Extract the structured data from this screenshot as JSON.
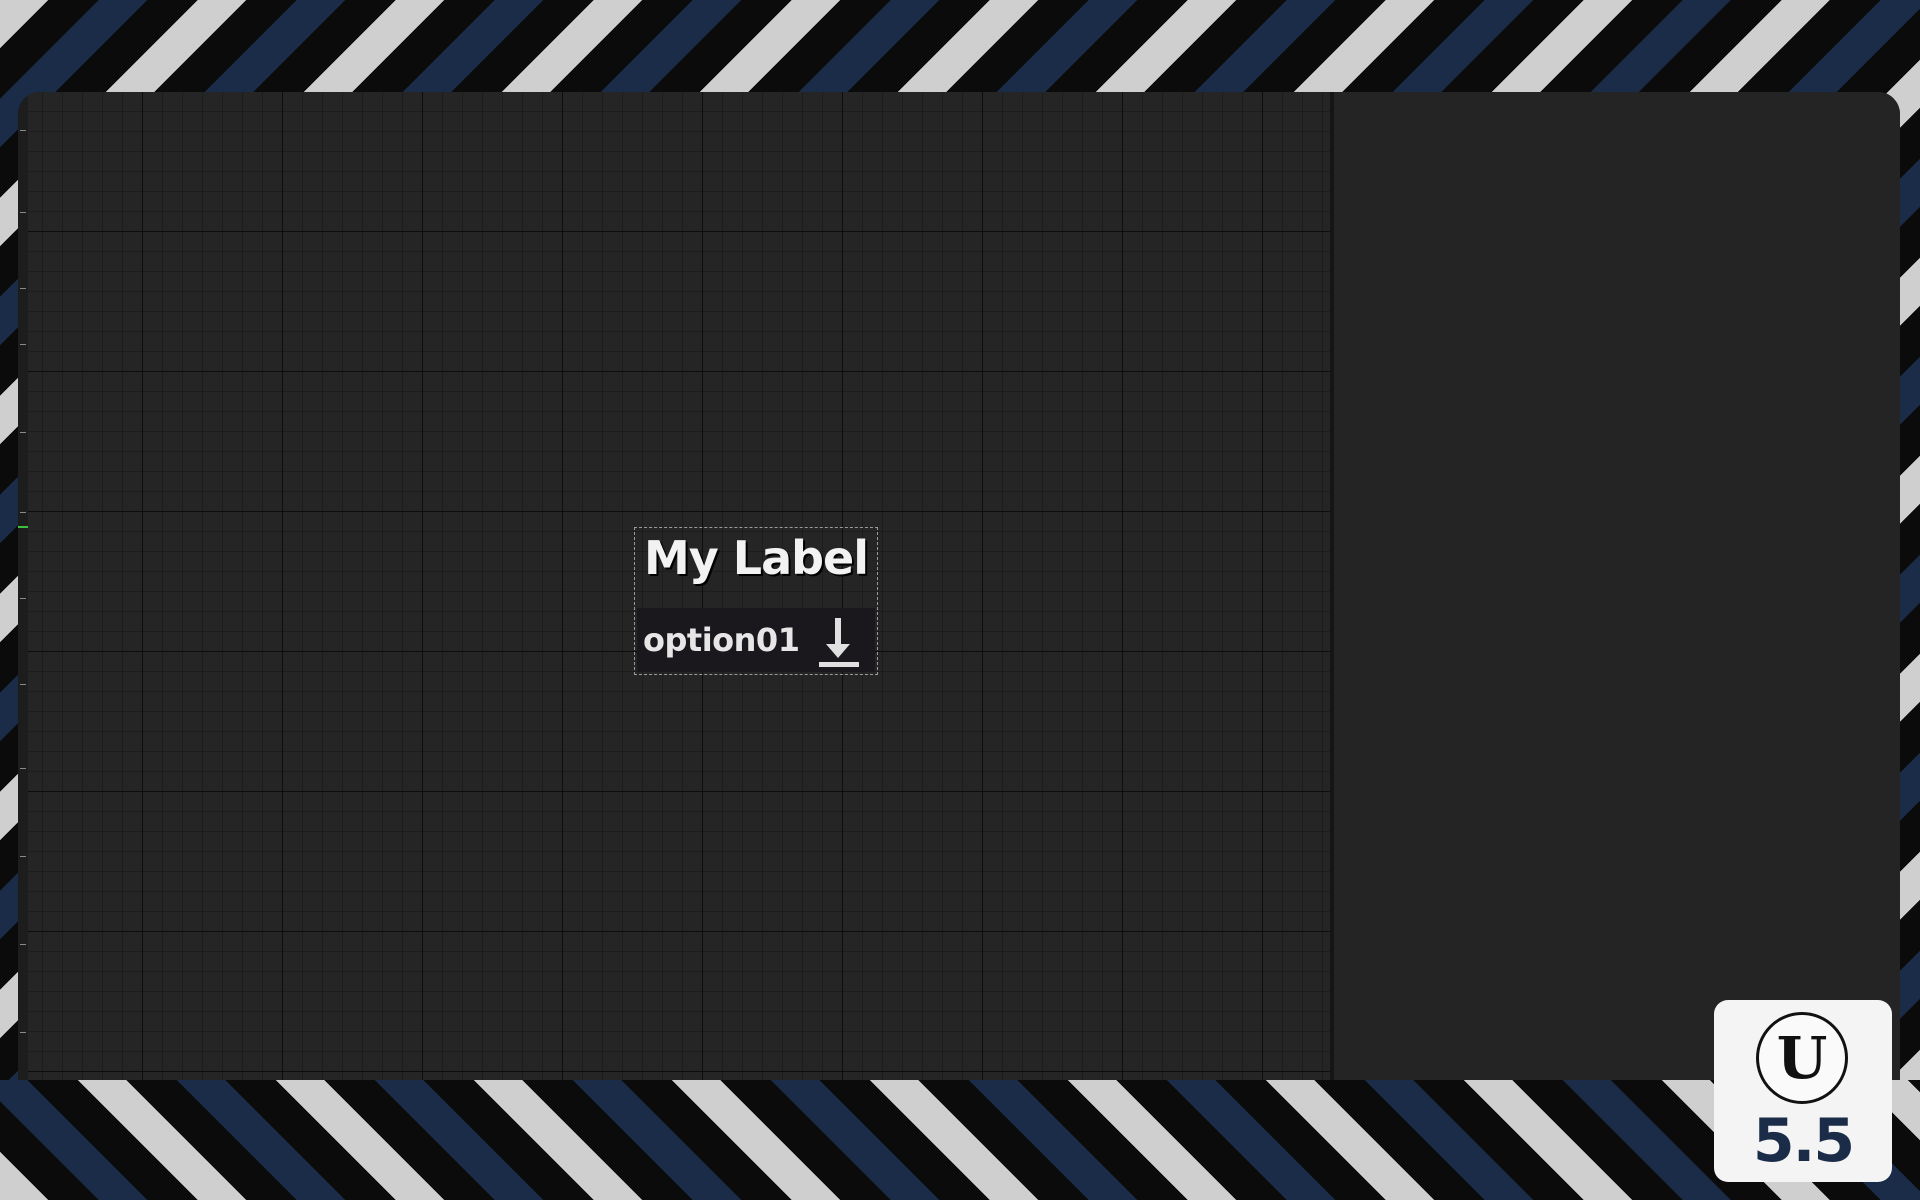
{
  "widget": {
    "label": "My Label",
    "combo_selected": "option01",
    "combo_icon": "download-arrow-icon"
  },
  "logo": {
    "letter": "U",
    "version": "5.5"
  },
  "colors": {
    "background_blue": "#1b2c49",
    "background_light": "#cfcfcf",
    "panel_dark": "#232323",
    "ruler_marker": "#3fbf3f"
  }
}
